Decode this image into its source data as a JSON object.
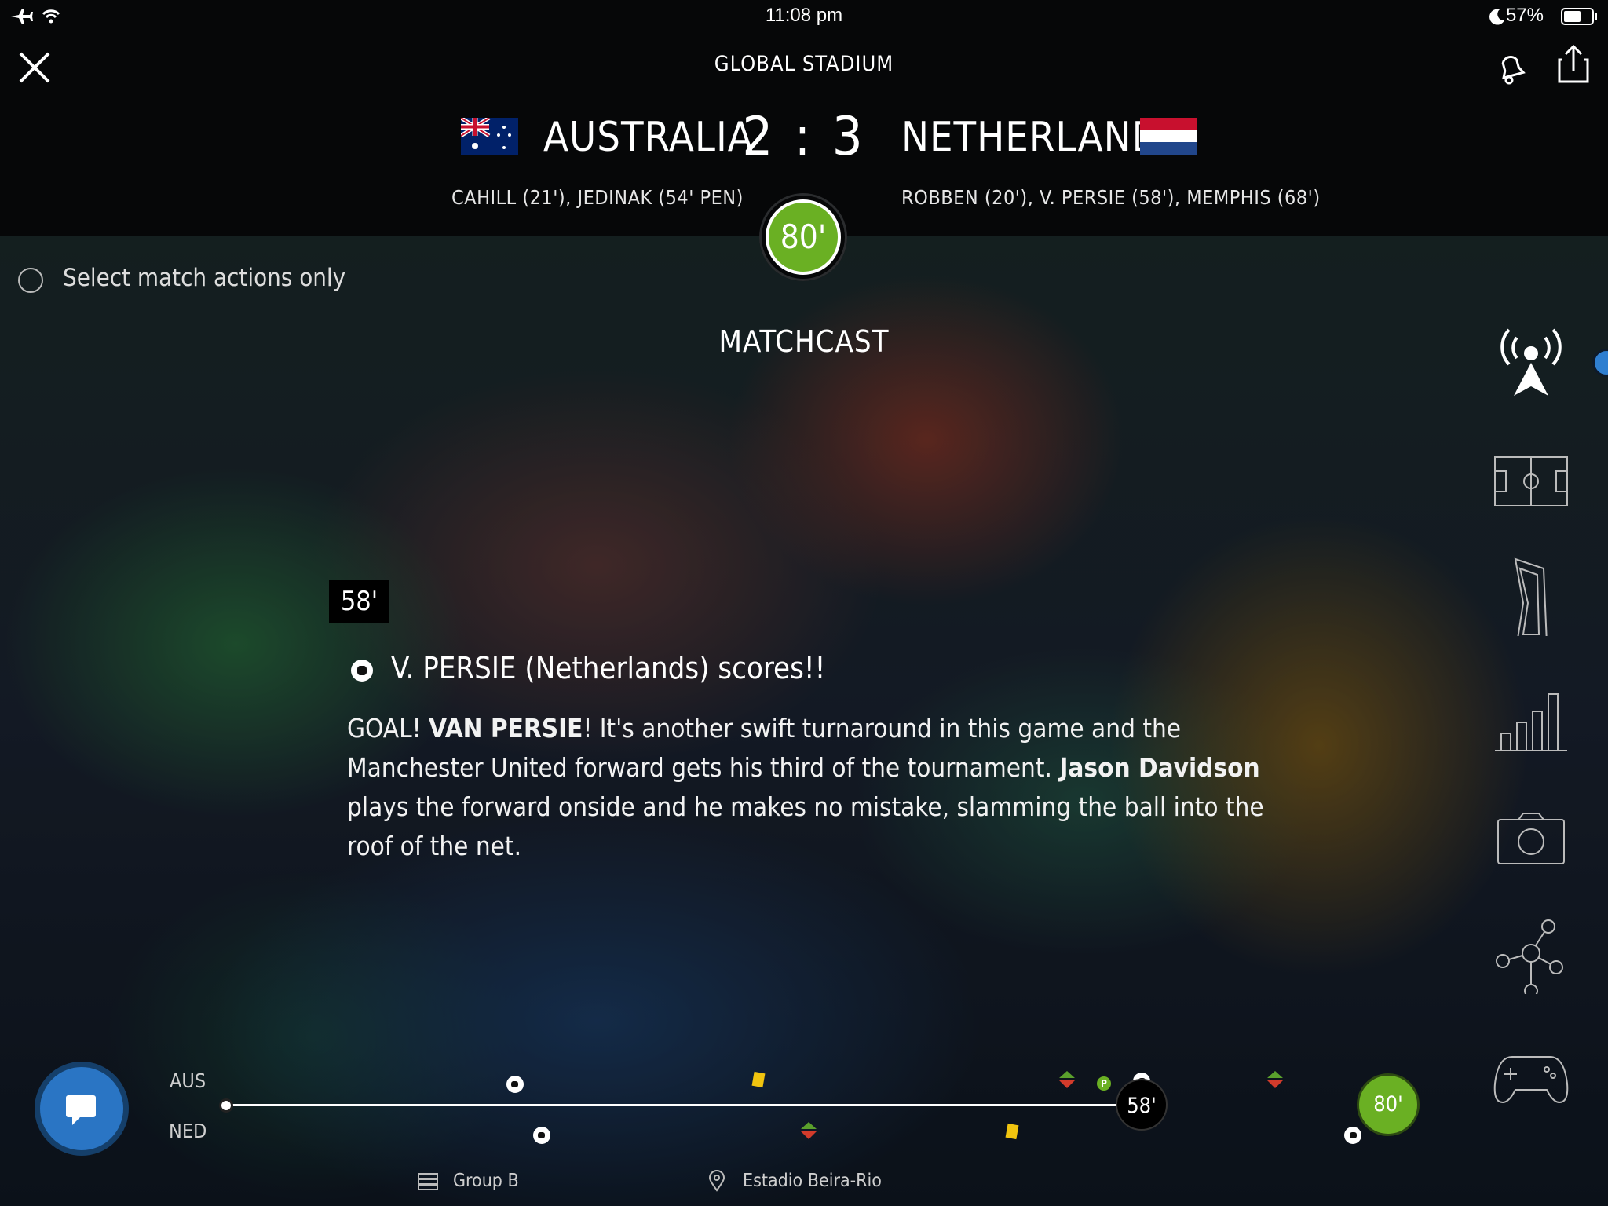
{
  "status_bar": {
    "time": "11:08 pm",
    "battery": "57%"
  },
  "header": {
    "stadium": "GLOBAL STADIUM",
    "home_team": "AUSTRALIA",
    "away_team": "NETHERLANDS",
    "score": "2 : 3",
    "home_scorers": "CAHILL (21'), JEDINAK (54' PEN)",
    "away_scorers": "ROBBEN (20'), V. PERSIE (58'), MEMPHIS (68')",
    "match_minute": "80'"
  },
  "filter": {
    "label": "Select match actions only"
  },
  "section_title": "MATCHCAST",
  "event": {
    "minute": "58'",
    "title": "V. PERSIE (Netherlands) scores!!",
    "body_1": "GOAL! ",
    "body_2": "VAN PERSIE",
    "body_3": "! It's another swift turnaround in this game and the Manchester United forward gets his third of the tournament. ",
    "body_4": "Jason Davidson",
    "body_5": " plays the forward onside and he makes no mistake, slamming the ball into the roof of the net."
  },
  "side_nav": [
    "live-icon",
    "pitch-icon",
    "stadium-icon",
    "stats-icon",
    "camera-icon",
    "network-icon",
    "gamepad-icon"
  ],
  "timeline": {
    "home_label": "AUS",
    "away_label": "NED",
    "current_marker": "58'",
    "live_marker": "80'",
    "penalty_badge": "P"
  },
  "footer": {
    "group": "Group B",
    "venue": "Estadio Beira-Rio"
  },
  "colors": {
    "accent_green": "#6ab023",
    "chat_blue": "#2a75c4",
    "yellow_card": "#f1c40f"
  }
}
